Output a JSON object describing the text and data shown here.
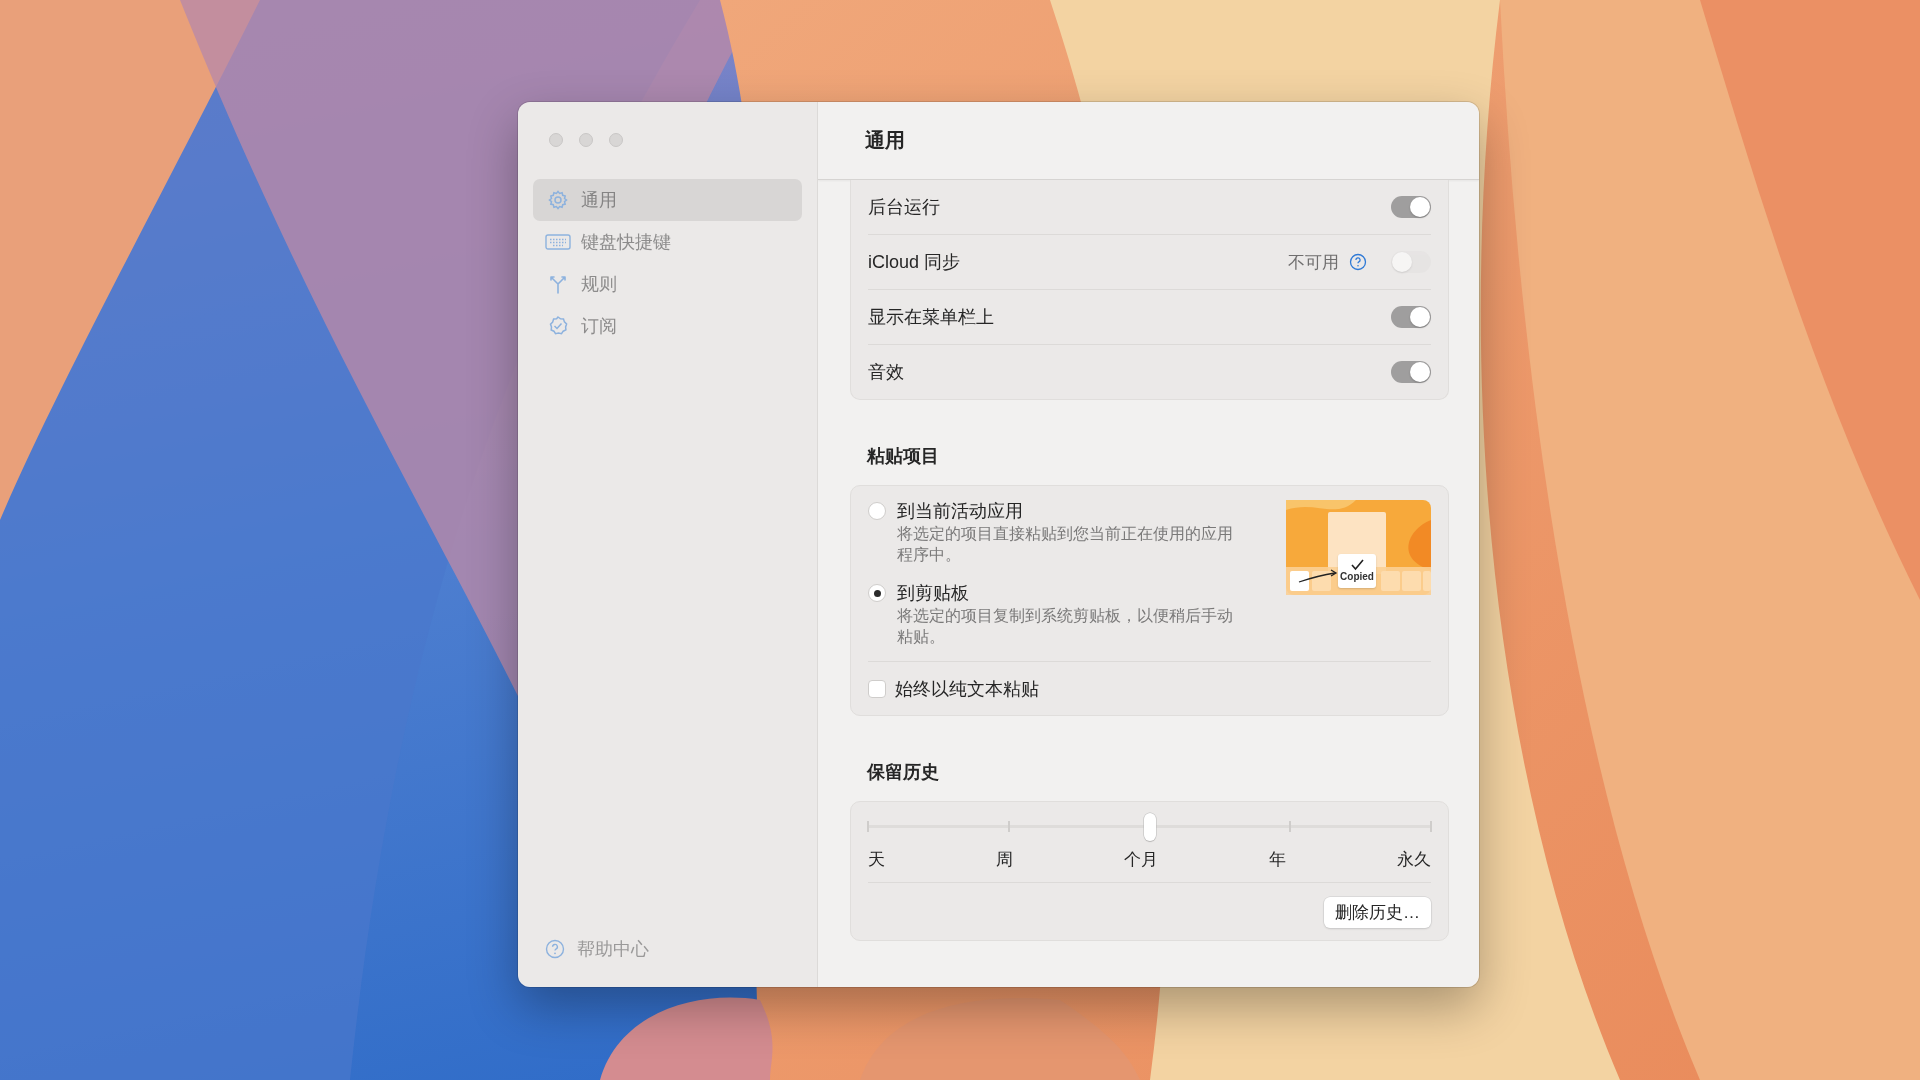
{
  "window": {
    "title": "通用"
  },
  "sidebar": {
    "items": [
      {
        "label": "通用",
        "selected": true
      },
      {
        "label": "键盘快捷键",
        "selected": false
      },
      {
        "label": "规则",
        "selected": false
      },
      {
        "label": "订阅",
        "selected": false
      }
    ],
    "help": "帮助中心"
  },
  "general_settings": [
    {
      "label": "后台运行",
      "on": true,
      "disabled": false
    },
    {
      "label": "iCloud 同步",
      "status": "不可用",
      "on": false,
      "disabled": true
    },
    {
      "label": "显示在菜单栏上",
      "on": true,
      "disabled": false
    },
    {
      "label": "音效",
      "on": true,
      "disabled": false
    }
  ],
  "paste_items": {
    "heading": "粘贴项目",
    "options": [
      {
        "label": "到当前活动应用",
        "description": "将选定的项目直接粘贴到您当前正在使用的应用程序中。",
        "selected": false
      },
      {
        "label": "到剪贴板",
        "description": "将选定的项目复制到系统剪贴板，以便稍后手动粘贴。",
        "selected": true
      }
    ],
    "illustration_caption": "Copied",
    "plain_text": {
      "label": "始终以纯文本粘贴",
      "checked": false
    }
  },
  "history": {
    "heading": "保留历史",
    "slider": {
      "level": 0.5,
      "labels": [
        "天",
        "周",
        "个月",
        "年",
        "永久"
      ]
    },
    "delete_button": "删除历史…"
  }
}
